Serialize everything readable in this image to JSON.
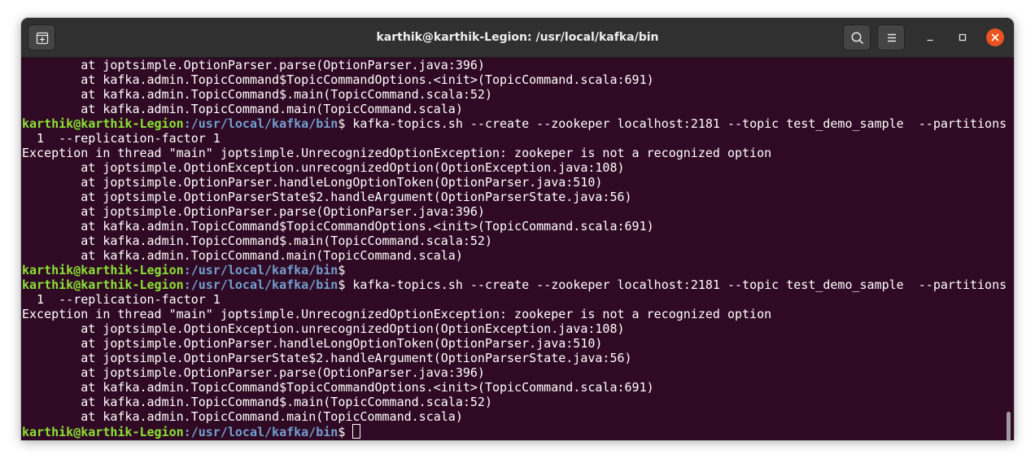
{
  "window": {
    "title": "karthik@karthik-Legion: /usr/local/kafka/bin"
  },
  "header": {
    "new_tab_icon": "new-tab-icon",
    "search_icon": "search-icon",
    "menu_icon": "hamburger-menu-icon",
    "minimize_icon": "minimize-icon",
    "maximize_icon": "maximize-icon",
    "close_icon": "close-icon"
  },
  "colors": {
    "terminal_bg": "#300a24",
    "titlebar_bg": "#303030",
    "prompt_user": "#8ae234",
    "prompt_path": "#729fcf",
    "close_button": "#e95420"
  },
  "terminal": {
    "lines": [
      {
        "type": "text",
        "text": "        at joptsimple.OptionParser.parse(OptionParser.java:396)"
      },
      {
        "type": "text",
        "text": "        at kafka.admin.TopicCommand$TopicCommandOptions.<init>(TopicCommand.scala:691)"
      },
      {
        "type": "text",
        "text": "        at kafka.admin.TopicCommand$.main(TopicCommand.scala:52)"
      },
      {
        "type": "text",
        "text": "        at kafka.admin.TopicCommand.main(TopicCommand.scala)"
      },
      {
        "type": "prompt",
        "user": "karthik@karthik-Legion",
        "path": ":/usr/local/kafka/bin",
        "symbol": "$",
        "command": " kafka-topics.sh --create --zookeper localhost:2181 --topic test_demo_sample  --partitions"
      },
      {
        "type": "text",
        "text": "  1  --replication-factor 1"
      },
      {
        "type": "text",
        "text": "Exception in thread \"main\" joptsimple.UnrecognizedOptionException: zookeper is not a recognized option"
      },
      {
        "type": "text",
        "text": "        at joptsimple.OptionException.unrecognizedOption(OptionException.java:108)"
      },
      {
        "type": "text",
        "text": "        at joptsimple.OptionParser.handleLongOptionToken(OptionParser.java:510)"
      },
      {
        "type": "text",
        "text": "        at joptsimple.OptionParserState$2.handleArgument(OptionParserState.java:56)"
      },
      {
        "type": "text",
        "text": "        at joptsimple.OptionParser.parse(OptionParser.java:396)"
      },
      {
        "type": "text",
        "text": "        at kafka.admin.TopicCommand$TopicCommandOptions.<init>(TopicCommand.scala:691)"
      },
      {
        "type": "text",
        "text": "        at kafka.admin.TopicCommand$.main(TopicCommand.scala:52)"
      },
      {
        "type": "text",
        "text": "        at kafka.admin.TopicCommand.main(TopicCommand.scala)"
      },
      {
        "type": "prompt",
        "user": "karthik@karthik-Legion",
        "path": ":/usr/local/kafka/bin",
        "symbol": "$",
        "command": ""
      },
      {
        "type": "prompt",
        "user": "karthik@karthik-Legion",
        "path": ":/usr/local/kafka/bin",
        "symbol": "$",
        "command": " kafka-topics.sh --create --zookeper localhost:2181 --topic test_demo_sample  --partitions"
      },
      {
        "type": "text",
        "text": "  1  --replication-factor 1"
      },
      {
        "type": "text",
        "text": "Exception in thread \"main\" joptsimple.UnrecognizedOptionException: zookeper is not a recognized option"
      },
      {
        "type": "text",
        "text": "        at joptsimple.OptionException.unrecognizedOption(OptionException.java:108)"
      },
      {
        "type": "text",
        "text": "        at joptsimple.OptionParser.handleLongOptionToken(OptionParser.java:510)"
      },
      {
        "type": "text",
        "text": "        at joptsimple.OptionParserState$2.handleArgument(OptionParserState.java:56)"
      },
      {
        "type": "text",
        "text": "        at joptsimple.OptionParser.parse(OptionParser.java:396)"
      },
      {
        "type": "text",
        "text": "        at kafka.admin.TopicCommand$TopicCommandOptions.<init>(TopicCommand.scala:691)"
      },
      {
        "type": "text",
        "text": "        at kafka.admin.TopicCommand$.main(TopicCommand.scala:52)"
      },
      {
        "type": "text",
        "text": "        at kafka.admin.TopicCommand.main(TopicCommand.scala)"
      },
      {
        "type": "prompt",
        "user": "karthik@karthik-Legion",
        "path": ":/usr/local/kafka/bin",
        "symbol": "$",
        "command": " ",
        "cursor": true
      }
    ]
  }
}
